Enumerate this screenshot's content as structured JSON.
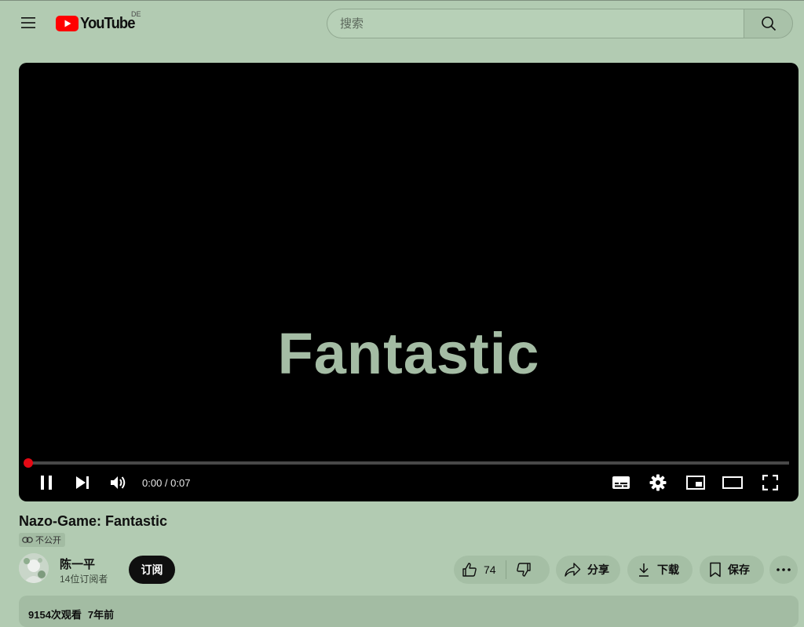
{
  "header": {
    "logo_text": "YouTube",
    "country_code": "DE",
    "search_placeholder": "搜索"
  },
  "player": {
    "frame_text": "Fantastic",
    "time_display": "0:00 / 0:07",
    "progress_fraction": 0.0
  },
  "video": {
    "title": "Nazo-Game: Fantastic",
    "privacy_label": "不公开"
  },
  "channel": {
    "name": "陈一平",
    "subscribers": "14位订阅者",
    "subscribe_label": "订阅"
  },
  "actions": {
    "like_count": "74",
    "share_label": "分享",
    "download_label": "下载",
    "save_label": "保存"
  },
  "description": {
    "views": "9154次观看",
    "age": "7年前"
  },
  "colors": {
    "page_background": "#b2cbb2",
    "progress_accent": "#e50914",
    "logo_red": "#ff0000"
  }
}
